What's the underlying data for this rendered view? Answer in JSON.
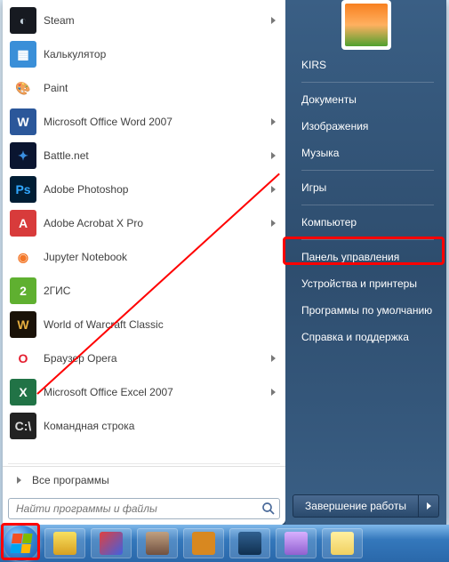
{
  "apps": [
    {
      "label": "Steam",
      "icon_bg": "#171a21",
      "icon_txt": "◐",
      "icon_color": "#c7d5e0",
      "has_arrow": true
    },
    {
      "label": "Калькулятор",
      "icon_bg": "#3a8fd8",
      "icon_txt": "▦",
      "icon_color": "#fff",
      "has_arrow": false
    },
    {
      "label": "Paint",
      "icon_bg": "#ffffff",
      "icon_txt": "🎨",
      "icon_color": "#e86a2a",
      "has_arrow": false
    },
    {
      "label": "Microsoft Office Word 2007",
      "icon_bg": "#2b579a",
      "icon_txt": "W",
      "icon_color": "#fff",
      "has_arrow": true
    },
    {
      "label": "Battle.net",
      "icon_bg": "#0a1530",
      "icon_txt": "✦",
      "icon_color": "#3a8fe0",
      "has_arrow": true
    },
    {
      "label": " Adobe Photoshop",
      "icon_bg": "#001d34",
      "icon_txt": "Ps",
      "icon_color": "#31a8ff",
      "has_arrow": true
    },
    {
      "label": "Adobe Acrobat X Pro",
      "icon_bg": "#d83b3b",
      "icon_txt": "A",
      "icon_color": "#fff",
      "has_arrow": true
    },
    {
      "label": "Jupyter Notebook",
      "icon_bg": "#ffffff",
      "icon_txt": "◉",
      "icon_color": "#f37626",
      "has_arrow": false
    },
    {
      "label": "2ГИС",
      "icon_bg": "#5fb030",
      "icon_txt": "2",
      "icon_color": "#fff",
      "has_arrow": false
    },
    {
      "label": "World of Warcraft Classic",
      "icon_bg": "#1a1208",
      "icon_txt": "W",
      "icon_color": "#e8b040",
      "has_arrow": false
    },
    {
      "label": "Браузер Opera",
      "icon_bg": "#ffffff",
      "icon_txt": "O",
      "icon_color": "#e41c2d",
      "has_arrow": true
    },
    {
      "label": "Microsoft Office Excel 2007",
      "icon_bg": "#217346",
      "icon_txt": "X",
      "icon_color": "#fff",
      "has_arrow": true
    },
    {
      "label": "Командная строка",
      "icon_bg": "#222222",
      "icon_txt": "C:\\",
      "icon_color": "#ddd",
      "has_arrow": false
    }
  ],
  "all_programs_label": "Все программы",
  "search": {
    "placeholder": "Найти программы и файлы"
  },
  "right": {
    "username": "KIRS",
    "groups": [
      [
        "Документы",
        "Изображения",
        "Музыка"
      ],
      [
        "Игры"
      ],
      [
        "Компьютер"
      ],
      [
        "Панель управления",
        "Устройства и принтеры",
        "Программы по умолчанию",
        "Справка и поддержка"
      ]
    ],
    "shutdown_label": "Завершение работы"
  },
  "taskbar_icons": [
    {
      "bg": "linear-gradient(180deg,#f8e060,#d8a020)"
    },
    {
      "bg": "linear-gradient(135deg,#e04040,#4060e0)"
    },
    {
      "bg": "linear-gradient(180deg,#c0a080,#705040)"
    },
    {
      "bg": "#d88820"
    },
    {
      "bg": "linear-gradient(180deg,#306090,#103050)"
    },
    {
      "bg": "linear-gradient(180deg,#d8b0ff,#9060d0)"
    },
    {
      "bg": "linear-gradient(180deg,#fff0a0,#f0d060)"
    }
  ]
}
